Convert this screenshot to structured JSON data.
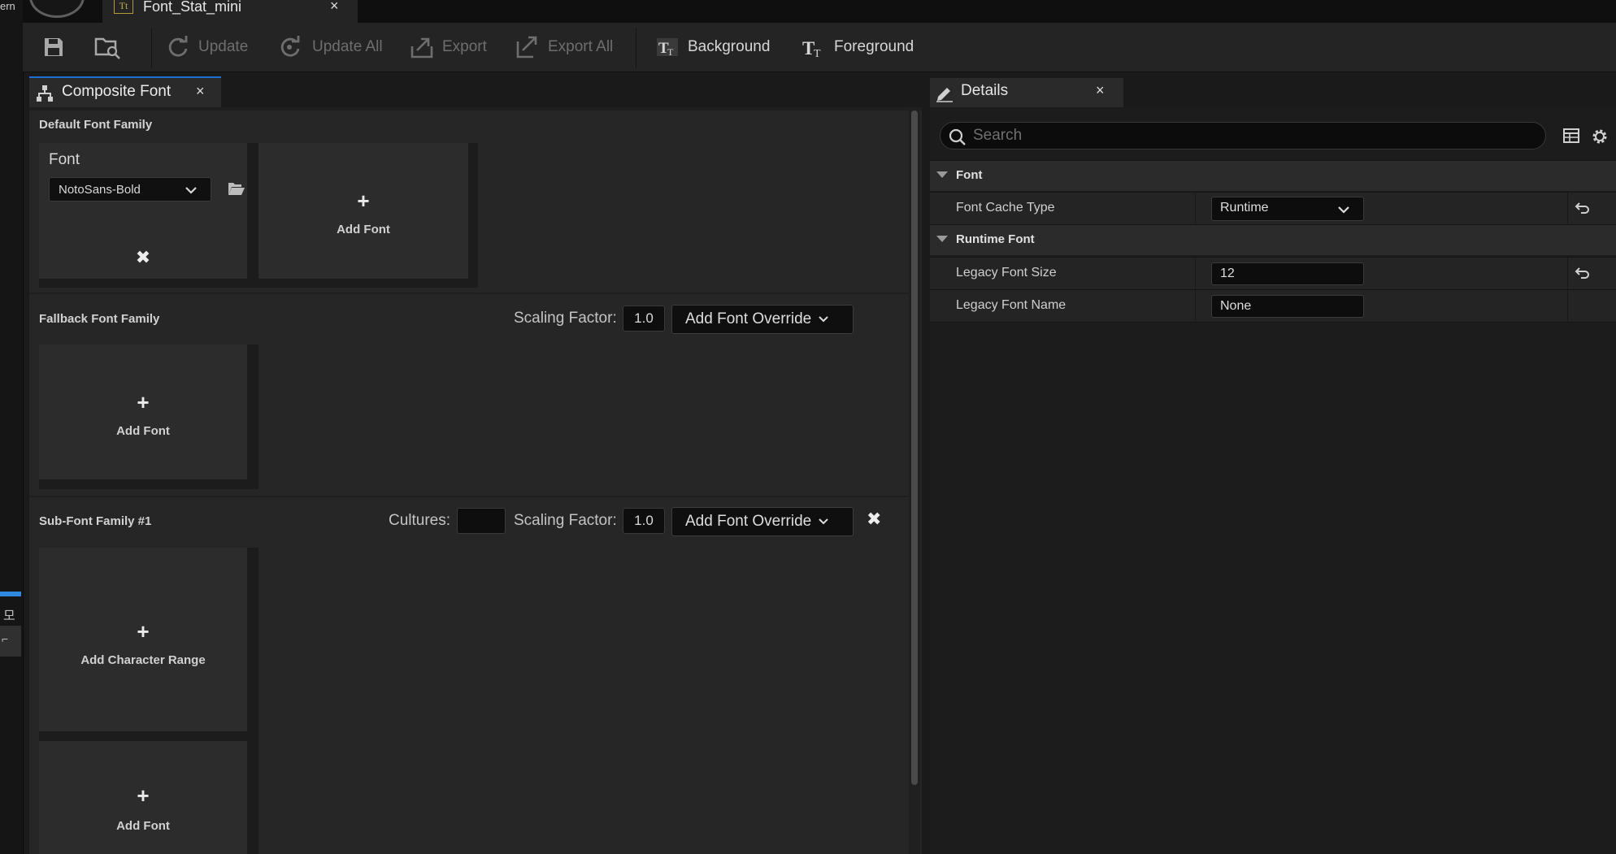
{
  "gutter": {
    "fragment": "ern",
    "ko_char": "모"
  },
  "asset_tab": {
    "icon_text": "Tt",
    "title": "Font_Stat_mini",
    "close": "×"
  },
  "toolbar": {
    "update": "Update",
    "update_all": "Update All",
    "export": "Export",
    "export_all": "Export All",
    "background": "Background",
    "foreground": "Foreground"
  },
  "composite_font": {
    "tab_title": "Composite Font",
    "close": "×",
    "default_family": {
      "title": "Default Font Family",
      "font_label": "Font",
      "font_value": "NotoSans-Bold",
      "remove": "✖",
      "add_plus": "+",
      "add_font": "Add Font"
    },
    "fallback_family": {
      "title": "Fallback Font Family",
      "scaling_label": "Scaling Factor:",
      "scaling_value": "1.0",
      "override_button": "Add Font Override",
      "add_plus": "+",
      "add_font": "Add Font"
    },
    "sub_family": {
      "title": "Sub-Font Family #1",
      "cultures_label": "Cultures:",
      "cultures_value": "",
      "scaling_label": "Scaling Factor:",
      "scaling_value": "1.0",
      "override_button": "Add Font Override",
      "remove": "✖",
      "add_range_plus": "+",
      "add_range": "Add Character Range",
      "add_plus": "+",
      "add_font": "Add Font"
    }
  },
  "details": {
    "tab_title": "Details",
    "close": "×",
    "search_placeholder": "Search",
    "categories": [
      {
        "title": "Font"
      },
      {
        "title": "Runtime Font"
      }
    ],
    "props": {
      "font_cache_type": {
        "name": "Font Cache Type",
        "value": "Runtime"
      },
      "legacy_font_size": {
        "name": "Legacy Font Size",
        "value": "12"
      },
      "legacy_font_name": {
        "name": "Legacy Font Name",
        "value": "None"
      }
    }
  },
  "colors": {
    "accent": "#1e6fd0",
    "panel": "#262626",
    "input": "#0e0e0e"
  }
}
